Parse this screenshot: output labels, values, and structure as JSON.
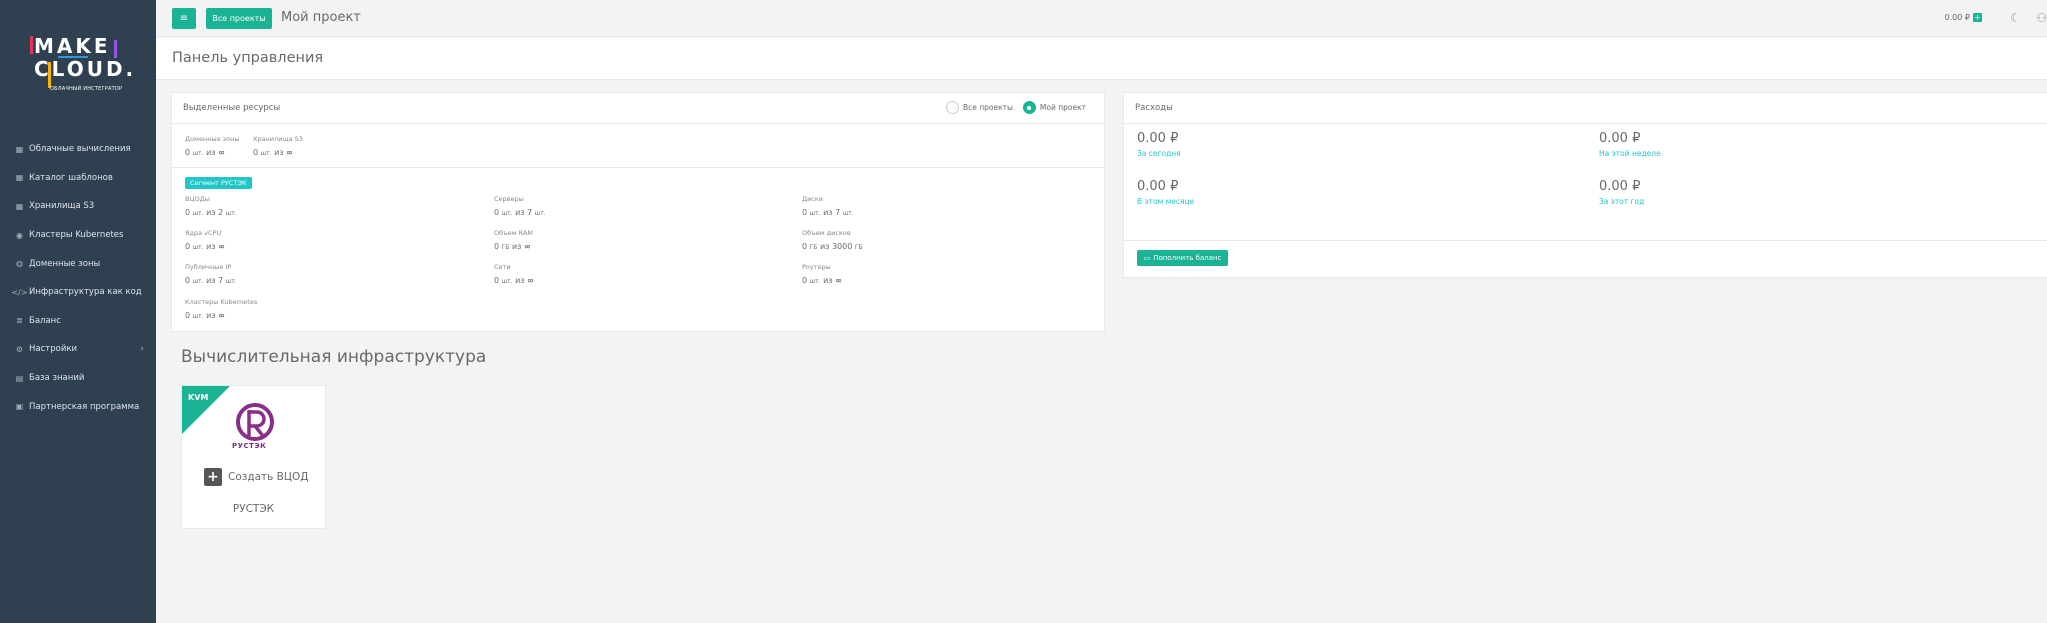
{
  "logo": {
    "line1": "MAKE",
    "line2": "CLOUD.",
    "tagline": "ОБЛАЧНЫЙ ИНСТЕГРАТОР"
  },
  "sidebar": {
    "items": [
      {
        "label": "Облачные вычисления",
        "icon": "table-icon"
      },
      {
        "label": "Каталог шаблонов",
        "icon": "table-icon"
      },
      {
        "label": "Хранилища S3",
        "icon": "table-icon"
      },
      {
        "label": "Кластеры Kubernetes",
        "icon": "cube-icon"
      },
      {
        "label": "Доменные зоны",
        "icon": "globe-icon"
      },
      {
        "label": "Инфраструктура как код",
        "icon": "code-icon"
      },
      {
        "label": "Баланс",
        "icon": "database-icon"
      },
      {
        "label": "Настройки",
        "icon": "cogs-icon"
      },
      {
        "label": "База знаний",
        "icon": "book-icon"
      },
      {
        "label": "Партнерская программа",
        "icon": "briefcase-icon"
      }
    ]
  },
  "topbar": {
    "menu_icon": "≡",
    "all_projects": "Все проекты",
    "project_title": "Мой проект",
    "balance": "0.00 ₽",
    "plus": "+"
  },
  "heading": {
    "title": "Панель управления"
  },
  "resources": {
    "title": "Выделенные ресурсы",
    "radio_all": "Все проекты",
    "radio_mine": "Мой проект",
    "domain_zones_label": "Доменные зоны",
    "domain_zones_value": "0",
    "s3_label": "Хранилища S3",
    "s3_value": "0",
    "segment": "Сегмент РУСТЭК",
    "vdc_label": "ВЦОДы",
    "vdc_value": "0",
    "vdc_max": "2",
    "servers_label": "Серверы",
    "servers_value": "0",
    "servers_max": "7",
    "disks_label": "Диски",
    "disks_value": "0",
    "disks_max": "7",
    "vcpu_label": "Ядра vCPU",
    "vcpu_value": "0",
    "ram_label": "Объем RAM",
    "ram_value": "0",
    "disk_vol_label": "Объем дисков",
    "disk_vol_value": "0",
    "disk_vol_max": "3000",
    "ip_label": "Публичные IP",
    "ip_value": "0",
    "ip_max": "7",
    "net_label": "Сети",
    "net_value": "0",
    "routers_label": "Роутеры",
    "routers_value": "0",
    "k8s_label": "Кластеры Kubernetes",
    "k8s_value": "0",
    "units_pcs": "шт.",
    "units_gb": "ГБ",
    "of": "из",
    "infinity": "∞"
  },
  "expenses": {
    "title": "Расходы",
    "today_value": "0.00 ₽",
    "today_label": "За сегодня",
    "week_value": "0.00 ₽",
    "week_label": "На этой неделе",
    "month_value": "0.00 ₽",
    "month_label": "В этом месяце",
    "year_value": "0.00 ₽",
    "year_label": "За этот год",
    "topup": "Пополнить баланс"
  },
  "infra": {
    "title": "Вычислительная инфраструктура",
    "ribbon": "KVM",
    "brand": "РУСТЭК",
    "create": "Создать ВЦОД",
    "card_name": "РУСТЭК"
  }
}
